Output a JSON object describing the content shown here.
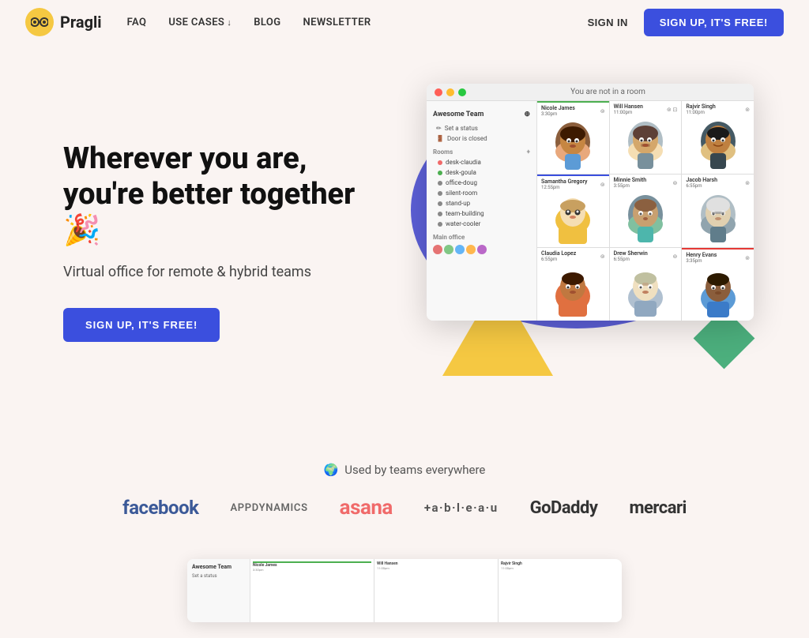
{
  "nav": {
    "logo_text": "Pragli",
    "links": [
      {
        "label": "FAQ",
        "id": "faq",
        "has_arrow": false
      },
      {
        "label": "USE CASES",
        "id": "use-cases",
        "has_arrow": true
      },
      {
        "label": "BLOG",
        "id": "blog",
        "has_arrow": false
      },
      {
        "label": "NEWSLETTER",
        "id": "newsletter",
        "has_arrow": false
      }
    ],
    "sign_in_label": "SIGN IN",
    "sign_up_label": "SIGN UP, IT'S FREE!"
  },
  "hero": {
    "title": "Wherever you are, you're better together 🎉",
    "subtitle": "Virtual office for remote & hybrid teams",
    "cta_label": "SIGN UP, IT'S FREE!"
  },
  "app": {
    "titlebar_text": "You are not in a room",
    "sidebar": {
      "team_name": "Awesome Team",
      "status_items": [
        {
          "label": "Set a status"
        },
        {
          "label": "Door is closed"
        }
      ],
      "rooms_label": "Rooms",
      "rooms": [
        {
          "label": "desk-claudia",
          "color": "#f06a6a"
        },
        {
          "label": "desk-goula",
          "color": "#4caf50"
        },
        {
          "label": "office-doug",
          "color": "#888"
        },
        {
          "label": "silent-room",
          "color": "#888"
        },
        {
          "label": "stand-up",
          "color": "#888"
        },
        {
          "label": "team-building",
          "color": "#888"
        },
        {
          "label": "water-cooler",
          "color": "#888"
        }
      ],
      "main_office_label": "Main office"
    },
    "grid": [
      {
        "name": "Nicole James",
        "time": "3:30pm",
        "active": true,
        "status": "green"
      },
      {
        "name": "Will Hansen",
        "time": "11:00pm",
        "active": false,
        "status": "none"
      },
      {
        "name": "Rajvir Singh",
        "time": "11:00pm",
        "active": false,
        "status": "none"
      },
      {
        "name": "Samantha Gregory",
        "time": "12:55pm",
        "active": true,
        "status": "blue"
      },
      {
        "name": "Minnie Smith",
        "time": "3:55pm",
        "active": false,
        "status": "none"
      },
      {
        "name": "Jacob Harsh",
        "time": "6:55pm",
        "active": false,
        "status": "none"
      },
      {
        "name": "Claudia Lopez",
        "time": "6:55pm",
        "active": false,
        "status": "none"
      },
      {
        "name": "Drew Sherwin",
        "time": "6:55pm",
        "active": false,
        "status": "none"
      },
      {
        "name": "Henry Evans",
        "time": "3:35pm",
        "active": false,
        "status": "red"
      }
    ]
  },
  "brands": {
    "label": "Used by teams everywhere",
    "globe_emoji": "🌍",
    "logos": [
      {
        "name": "facebook",
        "display": "facebook"
      },
      {
        "name": "appdynamics",
        "display": "APPDYNAMICS"
      },
      {
        "name": "asana",
        "display": "asana"
      },
      {
        "name": "tableau",
        "display": "+a·b·l·e·a·u"
      },
      {
        "name": "godaddy",
        "display": "GoDaddy"
      },
      {
        "name": "mercari",
        "display": "mercari"
      }
    ]
  },
  "bottom_preview": {
    "sidebar_team": "Awesome Team",
    "sidebar_status": "Set a status",
    "cells": [
      {
        "name": "Nicole James",
        "time": "3:30pm"
      },
      {
        "name": "Will Hansen",
        "time": "11:00pm"
      },
      {
        "name": "Rajvir Singh",
        "time": "11:00pm"
      }
    ]
  }
}
